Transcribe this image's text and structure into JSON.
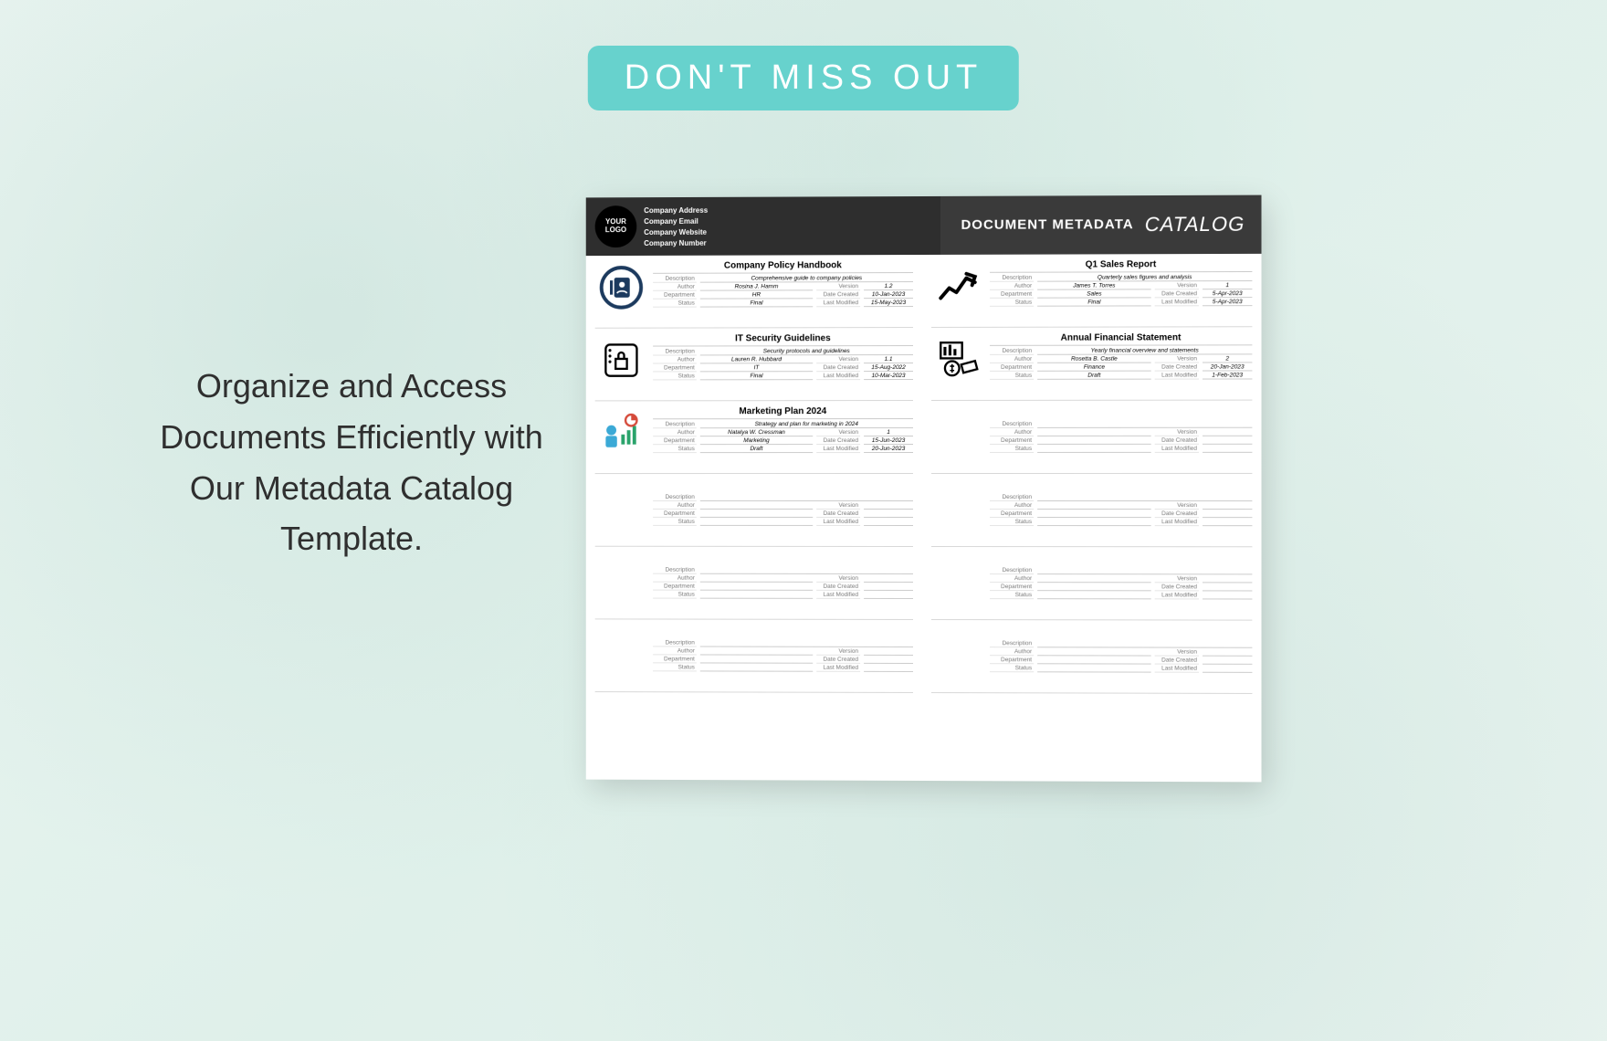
{
  "badge": "DON'T MISS OUT",
  "headline": "Organize and Access Documents Efficiently with Our Metadata Catalog Template.",
  "logo": "YOUR LOGO",
  "company_fields": [
    "Company Address",
    "Company Email",
    "Company Website",
    "Company Number"
  ],
  "header_title_1": "DOCUMENT METADATA",
  "header_title_2": "CATALOG",
  "labels": {
    "description": "Description",
    "author": "Author",
    "department": "Department",
    "status": "Status",
    "version": "Version",
    "date_created": "Date Created",
    "last_modified": "Last Modified"
  },
  "cards": [
    {
      "title": "Company Policy Handbook",
      "description": "Comprehensive guide to company policies",
      "author": "Rosina J. Hamm",
      "department": "HR",
      "status": "Final",
      "version": "1.2",
      "date_created": "10-Jan-2023",
      "last_modified": "15-May-2023",
      "icon": "contacts"
    },
    {
      "title": "Q1 Sales Report",
      "description": "Quarterly sales figures and analysis",
      "author": "James T. Torres",
      "department": "Sales",
      "status": "Final",
      "version": "1",
      "date_created": "5-Apr-2023",
      "last_modified": "5-Apr-2023",
      "icon": "trend"
    },
    {
      "title": "IT Security Guidelines",
      "description": "Security protocols and guidelines",
      "author": "Lauren R. Hubbard",
      "department": "IT",
      "status": "Final",
      "version": "1.1",
      "date_created": "15-Aug-2022",
      "last_modified": "10-Mar-2023",
      "icon": "lock"
    },
    {
      "title": "Annual Financial Statement",
      "description": "Yearly financial overview and statements",
      "author": "Rosetta B. Castle",
      "department": "Finance",
      "status": "Draft",
      "version": "2",
      "date_created": "20-Jan-2023",
      "last_modified": "1-Feb-2023",
      "icon": "finance"
    },
    {
      "title": "Marketing Plan 2024",
      "description": "Strategy and plan for marketing in 2024",
      "author": "Natalya W. Cressman",
      "department": "Marketing",
      "status": "Draft",
      "version": "1",
      "date_created": "15-Jun-2023",
      "last_modified": "20-Jun-2023",
      "icon": "marketing"
    }
  ],
  "empty_slots": 5
}
